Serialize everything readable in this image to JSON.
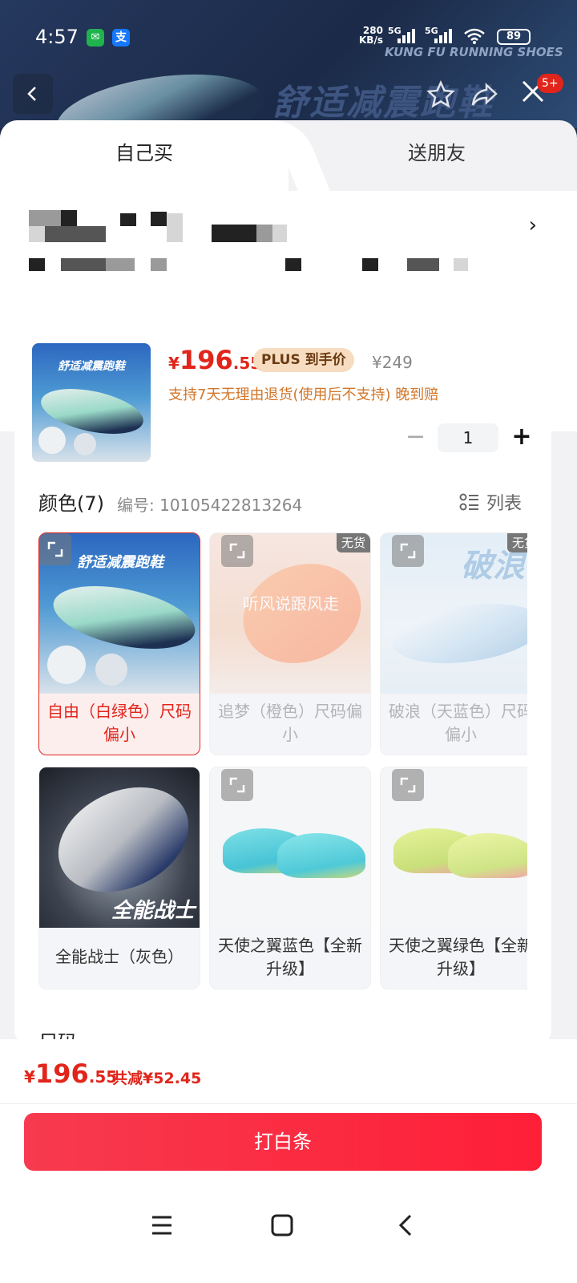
{
  "status_bar": {
    "time": "4:57",
    "wechat_icon": "wechat-icon",
    "alipay_glyph": "支",
    "net_speed_top": "280",
    "net_speed_unit": "KB/s",
    "network_1": "5G",
    "network_2": "5G",
    "battery": "89"
  },
  "background": {
    "brand": "KUNG FU RUNNING SHOES",
    "slogan": "舒适减震跑鞋"
  },
  "header": {
    "badge": "5+"
  },
  "tabs": {
    "self": "自己买",
    "friend": "送朋友"
  },
  "product": {
    "price_symbol": "¥",
    "price_int": "196",
    "price_dec": ".55",
    "plus_label": "PLUS 到手价",
    "original_price": "¥249",
    "policy": "支持7天无理由退货(使用后不支持) 晚到赔",
    "quantity": "1",
    "thumb_caption": "舒适减震跑鞋"
  },
  "color_section": {
    "title": "颜色(7)",
    "code": "编号: 10105422813264",
    "list_label": "列表",
    "options": [
      {
        "label": "自由（白绿色）尺码偏小",
        "selected": true,
        "out_of_stock": false,
        "img_text": "舒适减震跑鞋"
      },
      {
        "label": "追梦（橙色）尺码偏小",
        "selected": false,
        "out_of_stock": true,
        "oos_label": "无货",
        "img_text": "听风说跟风走"
      },
      {
        "label": "破浪（天蓝色）尺码偏小",
        "selected": false,
        "out_of_stock": true,
        "oos_label": "无货",
        "img_text": "破浪"
      },
      {
        "label": "全能战士（灰色）",
        "selected": false,
        "out_of_stock": false,
        "img_text": "全能战士"
      },
      {
        "label": "天使之翼蓝色【全新升级】",
        "selected": false,
        "out_of_stock": false
      },
      {
        "label": "天使之翼绿色【全新升级】",
        "selected": false,
        "out_of_stock": false
      }
    ]
  },
  "size_section": {
    "title": "尺码"
  },
  "footer": {
    "price_symbol": "¥",
    "price_int": "196",
    "price_dec": ".55",
    "saving": "共减¥52.45",
    "cta": "打白条"
  },
  "colors": {
    "accent": "#e1251b",
    "cta": "#fe1f37",
    "plus_bg": "#f6dcc0",
    "policy": "#d2762a"
  }
}
